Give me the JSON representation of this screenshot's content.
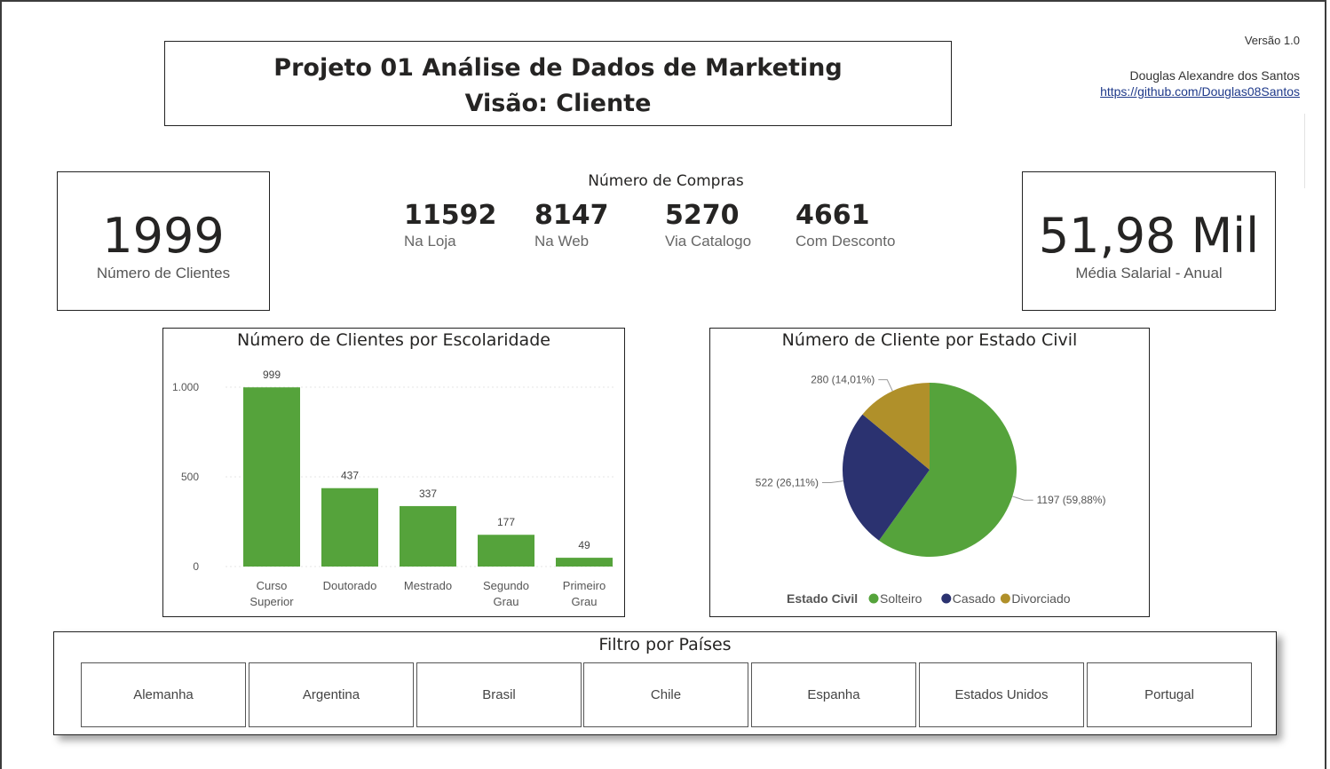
{
  "header": {
    "title_line1": "Projeto 01 Análise de Dados de Marketing",
    "title_line2": "Visão: Cliente",
    "version": "Versão 1.0",
    "author": "Douglas Alexandre dos Santos",
    "link": "https://github.com/Douglas08Santos"
  },
  "kpis": {
    "clientes": {
      "value": "1999",
      "label": "Número de Clientes"
    },
    "salario": {
      "value": "51,98 Mil",
      "label": "Média Salarial - Anual"
    }
  },
  "compras": {
    "title": "Número de Compras",
    "items": [
      {
        "value": "11592",
        "label": "Na Loja"
      },
      {
        "value": "8147",
        "label": "Na Web"
      },
      {
        "value": "5270",
        "label": "Via Catalogo"
      },
      {
        "value": "4661",
        "label": "Com Desconto"
      }
    ]
  },
  "colors": {
    "green": "#55a33b",
    "navy": "#2b3270",
    "gold": "#b0902a"
  },
  "chart_data": [
    {
      "type": "bar",
      "title": "Número de Clientes por Escolaridade",
      "categories": [
        [
          "Curso",
          "Superior"
        ],
        [
          "Doutorado"
        ],
        [
          "Mestrado"
        ],
        [
          "Segundo",
          "Grau"
        ],
        [
          "Primeiro",
          "Grau"
        ]
      ],
      "values": [
        999,
        437,
        337,
        177,
        49
      ],
      "data_labels": [
        "999",
        "437",
        "337",
        "177",
        "49"
      ],
      "yticks": [
        {
          "value": 0,
          "label": "0"
        },
        {
          "value": 500,
          "label": "500"
        },
        {
          "value": 1000,
          "label": "1.000"
        }
      ],
      "ylim": [
        0,
        1000
      ],
      "color": "#55a33b",
      "grid": true
    },
    {
      "type": "pie",
      "title": "Número de Cliente por Estado Civil",
      "legend_title": "Estado Civil",
      "legend_position": "bottom",
      "slices": [
        {
          "name": "Solteiro",
          "value": 1197,
          "label": "1197 (59,88%)",
          "color": "#55a33b"
        },
        {
          "name": "Casado",
          "value": 522,
          "label": "522 (26,11%)",
          "color": "#2b3270"
        },
        {
          "name": "Divorciado",
          "value": 280,
          "label": "280 (14,01%)",
          "color": "#b0902a"
        }
      ]
    }
  ],
  "filter": {
    "title": "Filtro por Países",
    "countries": [
      "Alemanha",
      "Argentina",
      "Brasil",
      "Chile",
      "Espanha",
      "Estados Unidos",
      "Portugal"
    ]
  }
}
